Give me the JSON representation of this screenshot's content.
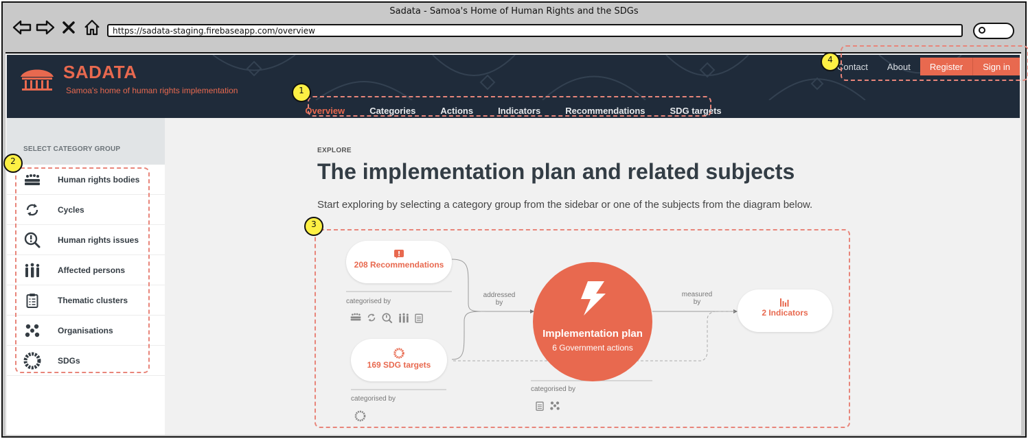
{
  "browser": {
    "window_title": "Sadata - Samoa's Home of Human Rights and the SDGs",
    "url": "https://sadata-staging.firebaseapp.com/overview"
  },
  "header": {
    "brand": "SADATA",
    "tagline": "Samoa's home of human rights implementation",
    "top_links": {
      "contact": "Contact",
      "about": "About",
      "register": "Register",
      "sign_in": "Sign in"
    },
    "nav": [
      "Overview",
      "Categories",
      "Actions",
      "Indicators",
      "Recommendations",
      "SDG targets"
    ],
    "active_nav": "Overview",
    "accent_color": "#e8694f",
    "bg_color": "#1f2b3a"
  },
  "sidebar": {
    "heading": "SELECT CATEGORY GROUP",
    "items": [
      {
        "label": "Human rights bodies",
        "icon": "bodies-icon"
      },
      {
        "label": "Cycles",
        "icon": "cycle-icon"
      },
      {
        "label": "Human rights issues",
        "icon": "issue-search-icon"
      },
      {
        "label": "Affected persons",
        "icon": "persons-icon"
      },
      {
        "label": "Thematic clusters",
        "icon": "clipboard-icon"
      },
      {
        "label": "Organisations",
        "icon": "organisations-icon"
      },
      {
        "label": "SDGs",
        "icon": "sdg-wheel-icon"
      }
    ]
  },
  "main": {
    "kicker": "EXPLORE",
    "title": "The implementation plan and related subjects",
    "intro": "Start exploring by selecting a category group from the sidebar or one of the subjects from the diagram below."
  },
  "diagram": {
    "recommendations": "208 Recommendations",
    "sdg_targets": "169 SDG targets",
    "plan_title": "Implementation plan",
    "plan_sub": "6 Government actions",
    "indicators": "2 Indicators",
    "addressed_by": [
      "addressed",
      "by"
    ],
    "measured_by": [
      "measured",
      "by"
    ],
    "categorised_by": "categorised by"
  },
  "annotations": [
    "1",
    "2",
    "3",
    "4"
  ]
}
